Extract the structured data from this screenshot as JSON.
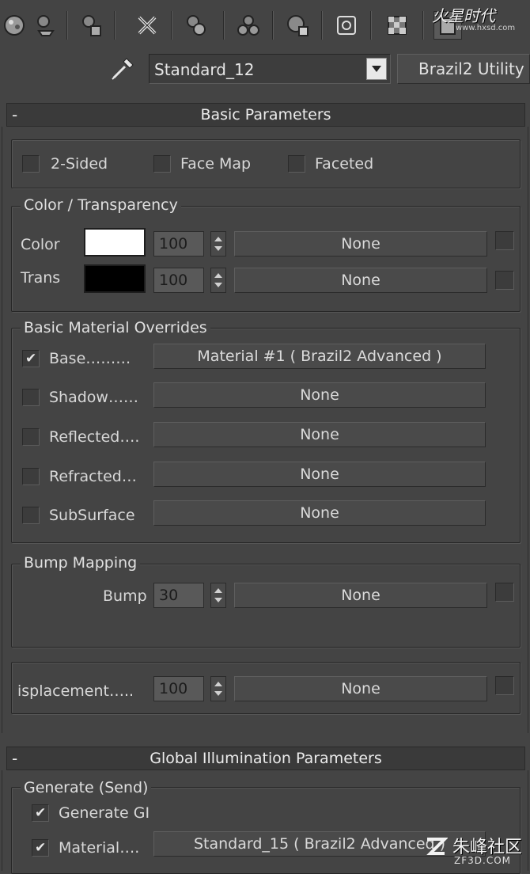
{
  "toolbar": {
    "icons": [
      "sphere-icon",
      "get-material-icon",
      "put-to-scene-icon",
      "assign-material-icon",
      "delete-icon",
      "copy-material-icon",
      "unique-material-icon",
      "material-effects-icon",
      "show-map-icon",
      "background-icon",
      "sample-uv-icon"
    ]
  },
  "material": {
    "name": "Standard_12",
    "type": "Brazil2 Utility"
  },
  "basic": {
    "header": "Basic Parameters",
    "collapse": "-",
    "flags": {
      "two_sided": "2-Sided",
      "face_map": "Face Map",
      "faceted": "Faceted"
    },
    "color_group": {
      "title": "Color / Transparency",
      "color_label": "Color",
      "color_value": "100",
      "color_map": "None",
      "color_swatch": "#ffffff",
      "trans_label": "Trans",
      "trans_value": "100",
      "trans_map": "None",
      "trans_swatch": "#000000"
    },
    "overrides": {
      "title": "Basic Material Overrides",
      "rows": [
        {
          "label": "Base………",
          "value": "Material #1  ( Brazil2 Advanced )",
          "checked": true
        },
        {
          "label": "Shadow……",
          "value": "None",
          "checked": false
        },
        {
          "label": "Reflected….",
          "value": "None",
          "checked": false
        },
        {
          "label": "Refracted…",
          "value": "None",
          "checked": false
        },
        {
          "label": "SubSurface",
          "value": "None",
          "checked": false
        }
      ]
    },
    "bump": {
      "title": "Bump Mapping",
      "label": "Bump",
      "value": "30",
      "map": "None"
    },
    "displacement": {
      "label": "isplacement…..",
      "value": "100",
      "map": "None"
    }
  },
  "gi": {
    "header": "Global Illumination Parameters",
    "collapse": "-",
    "generate_group": {
      "title": "Generate (Send)",
      "generate_gi": "Generate GI",
      "material_label": "Material….",
      "material_value": "Standard_15  ( Brazil2 Advanced )"
    }
  },
  "watermarks": {
    "top": "火星时代",
    "top_url": "www.hxsd.com",
    "bottom": "朱峰社区",
    "bottom_url": "ZF3D.COM"
  }
}
